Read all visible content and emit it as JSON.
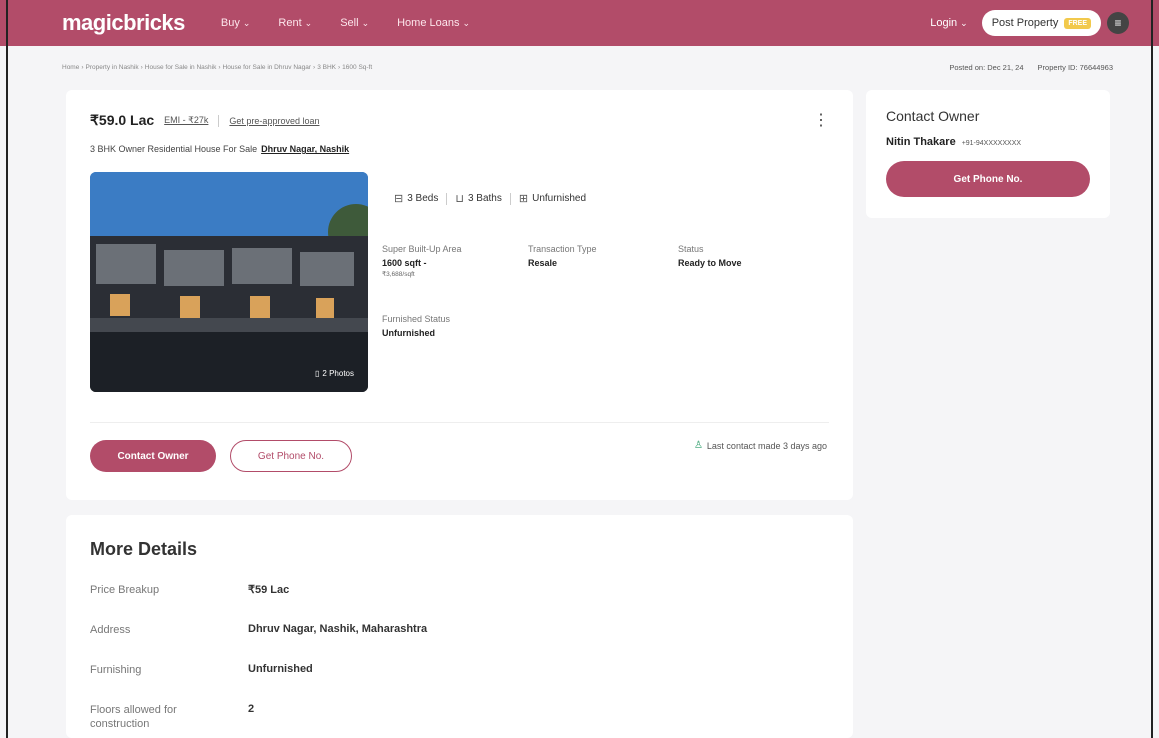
{
  "header": {
    "logo": "magicbricks",
    "nav": [
      {
        "label": "Buy"
      },
      {
        "label": "Rent"
      },
      {
        "label": "Sell"
      },
      {
        "label": "Home Loans"
      }
    ],
    "login": "Login",
    "post_property": "Post Property",
    "free_badge": "FREE"
  },
  "breadcrumb": [
    "Home",
    "Property in Nashik",
    "House for Sale in Nashik",
    "House for Sale in Dhruv Nagar",
    "3 BHK",
    "1600 Sq-ft"
  ],
  "posted_on": "Posted on: Dec 21, 24",
  "property_id": "Property ID: 76644963",
  "listing": {
    "price": "₹59.0 Lac",
    "emi": "EMI - ₹27k",
    "preapproved": "Get pre-approved loan",
    "subtitle": "3 BHK Owner Residential House For Sale",
    "location": "Dhruv Nagar, Nashik",
    "photo_count": "2 Photos",
    "beds": "3 Beds",
    "baths": "3 Baths",
    "furnishing_tag": "Unfurnished",
    "specs": {
      "area_label": "Super Built-Up Area",
      "area_value": "1600 sqft -",
      "area_rate": "₹3,688/sqft",
      "transaction_label": "Transaction Type",
      "transaction_value": "Resale",
      "status_label": "Status",
      "status_value": "Ready to Move",
      "furnished_label": "Furnished Status",
      "furnished_value": "Unfurnished"
    },
    "contact_owner": "Contact Owner",
    "get_phone": "Get Phone No.",
    "last_contact": "Last contact made 3 days ago"
  },
  "more_details": {
    "title": "More Details",
    "rows": [
      {
        "key": "Price Breakup",
        "value": "₹59 Lac"
      },
      {
        "key": "Address",
        "value": "Dhruv Nagar, Nashik, Maharashtra"
      },
      {
        "key": "Furnishing",
        "value": "Unfurnished"
      },
      {
        "key": "Floors allowed for construction",
        "value": "2"
      }
    ]
  },
  "contact_card": {
    "title": "Contact Owner",
    "name": "Nitin Thakare",
    "phone": "+91-94XXXXXXXX",
    "button": "Get Phone No."
  },
  "colors": {
    "brand": "#b24c69",
    "accent_green": "#2e9e6b"
  }
}
